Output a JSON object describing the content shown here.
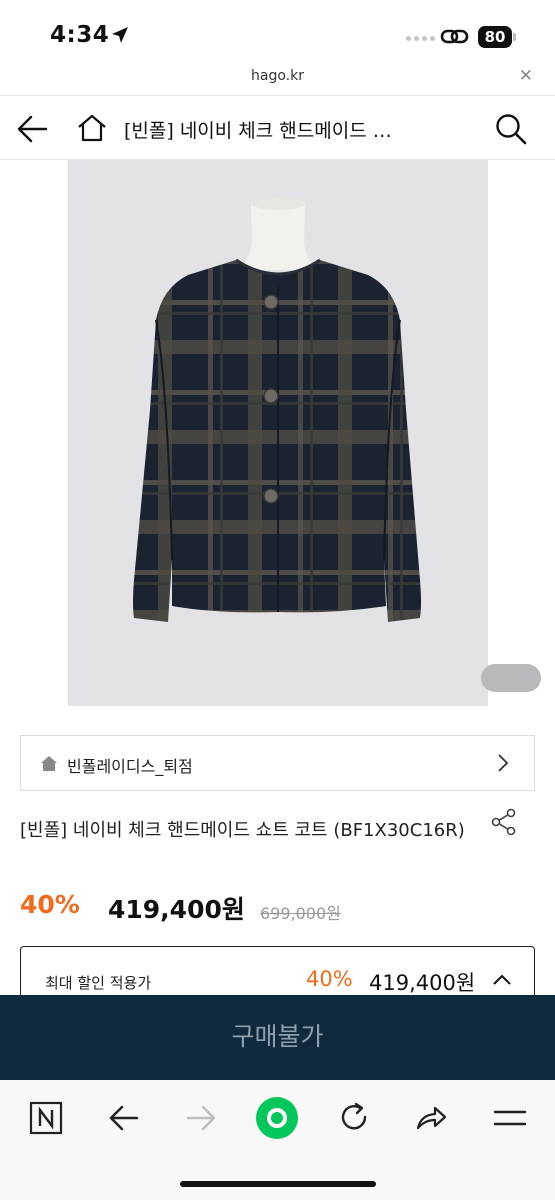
{
  "status_bar": {
    "time": "4:34",
    "battery": "80",
    "location_icon": "location-arrow-icon",
    "link_icon": "link-icon"
  },
  "browser": {
    "url": "hago.kr",
    "close_symbol": "✕"
  },
  "header": {
    "title": "[빈폴] 네이비 체크 핸드메이드 …",
    "back_icon": "back-arrow-icon",
    "home_icon": "home-icon",
    "search_icon": "search-icon"
  },
  "product": {
    "image_description": "navy check handmade short coat on mannequin",
    "store_name": "빈폴레이디스_퇴점",
    "title": "[빈폴] 네이비 체크 핸드메이드 쇼트 코트 (BF1X30C16R)",
    "discount_rate": "40%",
    "price": "419,400원",
    "original_price": "699,000원"
  },
  "max_discount": {
    "label": "최대 할인 적용가",
    "discount_rate": "40%",
    "price": "419,400원"
  },
  "buy_button": {
    "label": "구매불가"
  },
  "toolbar": {
    "items": [
      "naver-n-icon",
      "back-icon",
      "forward-icon",
      "green-dot-icon",
      "refresh-icon",
      "share-icon",
      "menu-icon"
    ]
  },
  "colors": {
    "accent_orange": "#f26b1d",
    "buy_bar": "#0f2a3c",
    "naver_green": "#03c75a"
  }
}
